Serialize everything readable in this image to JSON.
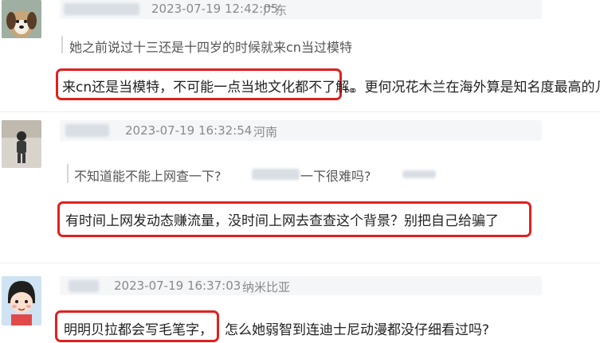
{
  "comments": [
    {
      "date": "2023-07-19 12:42:05",
      "location": "广东",
      "quote": "她之前说过十三还是十四岁的时候就来cn当过模特",
      "reply_highlight": "来cn还是当模特，不可能一点当地文化都不了解。",
      "reply_rest": "。。更何况花木兰在海外算是知名度最高的几个"
    },
    {
      "date": "2023-07-19 16:32:54",
      "location": "河南",
      "quote_part1": "不知道能不能上网查一下?",
      "quote_part2": "一下很难吗?",
      "reply_highlight": "有时间上网发动态赚流量，没时间上网去查查这个背景？别把自己给骗了"
    },
    {
      "date": "2023-07-19 16:37:03",
      "location": "纳米比亚",
      "reply_highlight": "明明贝拉都会写毛笔字，",
      "reply_rest": "怎么她弱智到连迪士尼动漫都没仔细看过吗?"
    }
  ]
}
